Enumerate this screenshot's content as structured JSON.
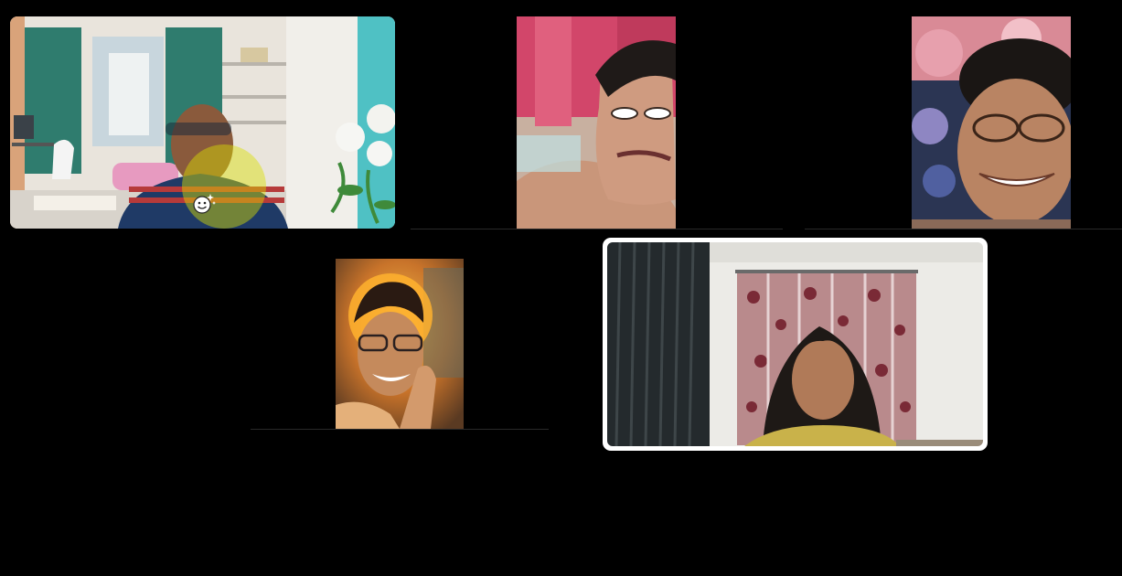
{
  "meeting": {
    "layout": "gallery",
    "participant_count": 5,
    "background_color": "#000000",
    "active_speaker_border_color": "#ffffff"
  },
  "tiles": [
    {
      "id": "participant-1",
      "video_on": true,
      "effect": "virtual-background-room",
      "reaction_icon": "sparkle-smiley-icon"
    },
    {
      "id": "participant-2",
      "video_on": true,
      "effect": "face-filter"
    },
    {
      "id": "participant-3",
      "video_on": true,
      "effect": "face-filter"
    },
    {
      "id": "participant-4",
      "video_on": true,
      "effect": "fire-filter"
    },
    {
      "id": "participant-5",
      "video_on": true,
      "active_speaker": true
    }
  ]
}
